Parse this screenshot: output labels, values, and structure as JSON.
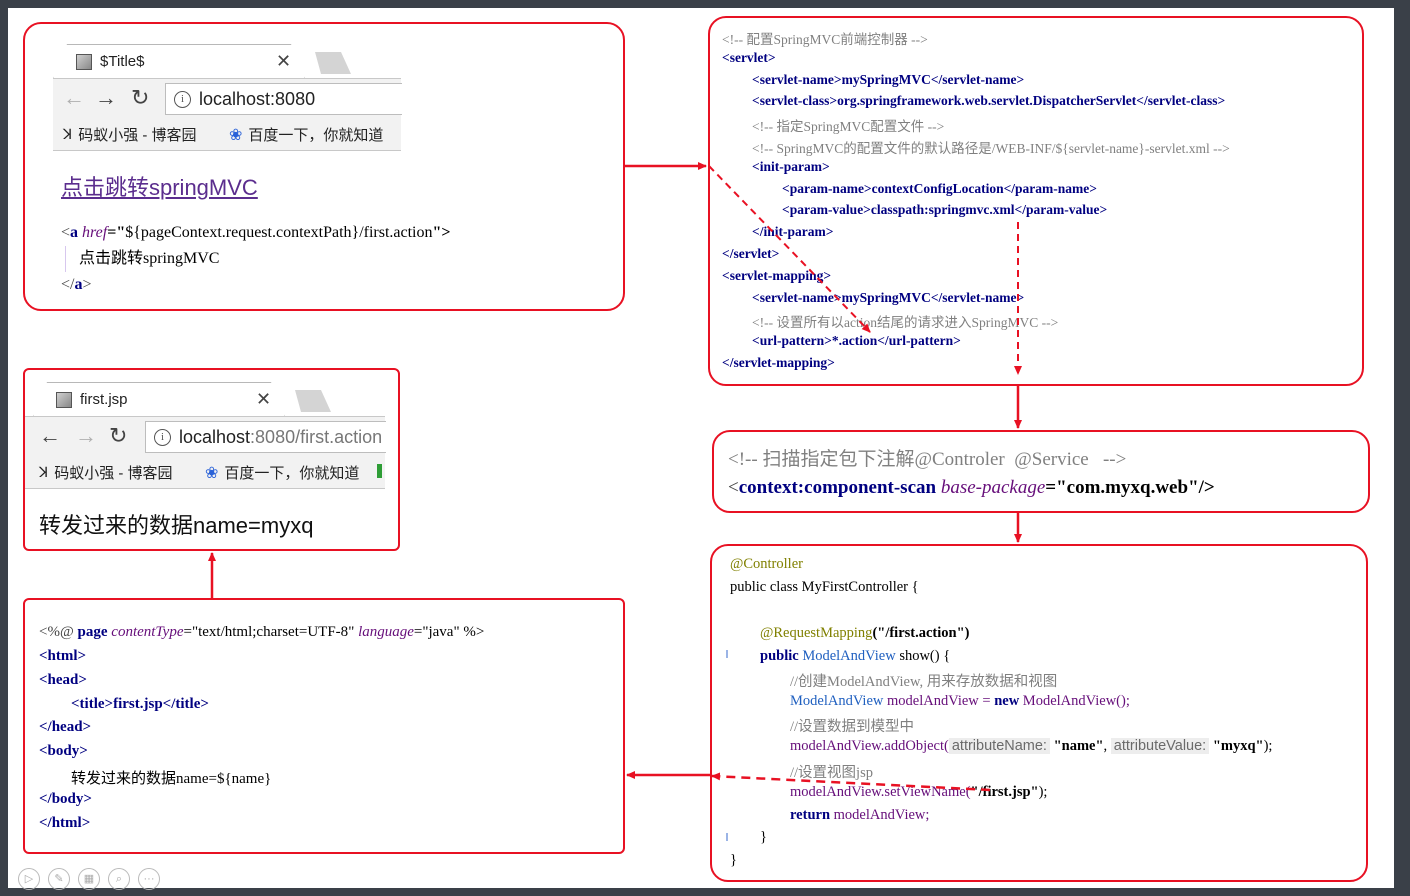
{
  "box1": {
    "tab_title": "$Title$",
    "url_host": "localhost:8080",
    "url_path": "",
    "bookmark1": "码蚁小强 - 博客园",
    "bookmark2": "百度一下，你就知道",
    "link_text": "点击跳转springMVC",
    "code": {
      "l1_open": "<",
      "l1_tag": "a ",
      "l1_attr": "href",
      "l1_eq": "=\"",
      "l1_val": "${pageContext.request.contextPath}/first.action",
      "l1_close": "\">",
      "l2": "点击跳转springMVC",
      "l3_open": "</",
      "l3_tag": "a",
      "l3_close": ">"
    }
  },
  "box2": {
    "lines": [
      "<!-- 配置SpringMVC前端控制器 -->",
      "<servlet>",
      "<servlet-name>mySpringMVC</servlet-name>",
      "<servlet-class>org.springframework.web.servlet.DispatcherServlet</servlet-class>",
      "<!-- 指定SpringMVC配置文件 -->",
      "<!-- SpringMVC的配置文件的默认路径是/WEB-INF/${servlet-name}-servlet.xml -->",
      "<init-param>",
      "<param-name>contextConfigLocation</param-name>",
      "<param-value>classpath:springmvc.xml</param-value>",
      "</init-param>",
      "</servlet>",
      "<servlet-mapping>",
      "<servlet-name>mySpringMVC</servlet-name>",
      "<!-- 设置所有以action结尾的请求进入SpringMVC -->",
      "<url-pattern>*.action</url-pattern>",
      "</servlet-mapping>"
    ]
  },
  "box3": {
    "comment": "<!-- 扫描指定包下注解@Controler  @Service   -->",
    "open": "<",
    "tag": "context:component-scan ",
    "attr": "base-package",
    "eq": "=\"",
    "val": "com.myxq.web",
    "close": "\"/>"
  },
  "box4": {
    "tab_title": "first.jsp",
    "url_host": "localhost",
    "url_path": ":8080/first.action",
    "bookmark1": "码蚁小强 - 博客园",
    "bookmark2": "百度一下，你就知道",
    "page_text": "转发过来的数据name=myxq"
  },
  "box5": {
    "annotation": "@Controller",
    "class_decl": "public class MyFirstController {",
    "mapping_ann": "@RequestMapping",
    "mapping_arg": "(\"/first.action\")",
    "method_kw": "public ",
    "method_type": "ModelAndView",
    "method_rest": " show() {",
    "c1": "//创建ModelAndView, 用来存放数据和视图",
    "new_type": "ModelAndView",
    "new_var": " modelAndView = ",
    "new_kw": "new ",
    "new_ctor": "ModelAndView();",
    "c2": "//设置数据到模型中",
    "add_call": "modelAndView.addObject(",
    "hint1": "attributeName:",
    "arg1": "\"name\"",
    "comma": ", ",
    "hint2": "attributeValue:",
    "arg2": "\"myxq\"",
    "add_end": ");",
    "c3": "//设置视图jsp",
    "set_call": "modelAndView.setViewName(",
    "set_arg": "\"/first.jsp\"",
    "set_end": ");",
    "ret_kw": "return ",
    "ret_val": "modelAndView;",
    "close_method": "}",
    "close_class": "}"
  },
  "box6": {
    "l1_a": "<%@ ",
    "l1_b": "page ",
    "l1_c": "contentType",
    "l1_d": "=\"",
    "l1_e": "text/html;charset=UTF-8",
    "l1_f": "\" ",
    "l1_g": "language",
    "l1_h": "=\"",
    "l1_i": "java",
    "l1_j": "\" %>",
    "lines": [
      "<html>",
      "<head>",
      "<title>first.jsp</title>",
      "</head>",
      "<body>",
      "转发过来的数据name=${name}",
      "</body>",
      "</html>"
    ]
  },
  "colors": {
    "border": "#e81123",
    "arrow": "#e81123"
  }
}
